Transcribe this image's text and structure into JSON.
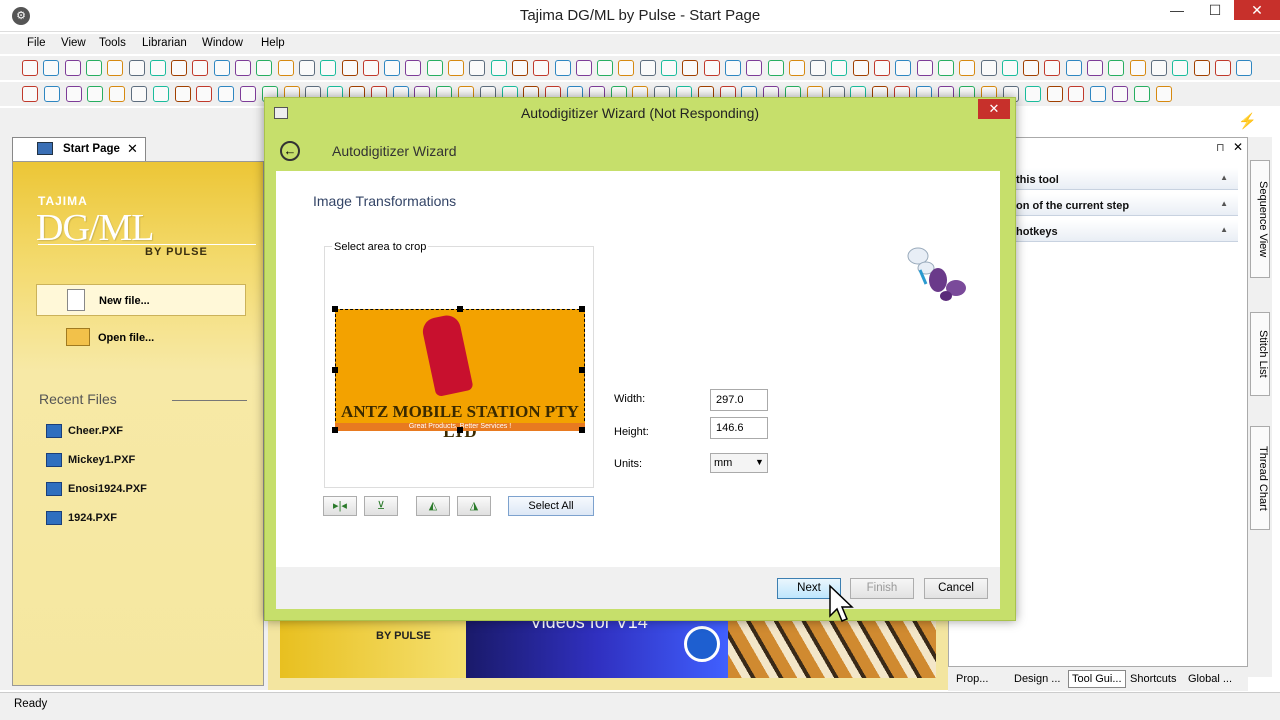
{
  "window": {
    "title": "Tajima DG/ML by Pulse - Start Page"
  },
  "menu": [
    "File",
    "View",
    "Tools",
    "Librarian",
    "Window",
    "Help"
  ],
  "tabs": {
    "start": "Start Page"
  },
  "start": {
    "logo_top": "TAJIMA",
    "logo_main": "DG/ML",
    "logo_by": "BY PULSE",
    "new_file": "New file...",
    "open_file": "Open file...",
    "recent_title": "Recent Files",
    "recent": [
      "Cheer.PXF",
      "Mickey1.PXF",
      "Enosi1924.PXF",
      "1924.PXF"
    ],
    "banner_text": "BY PULSE",
    "banner2_text": "Videos for V14"
  },
  "right": {
    "sections": [
      "this tool",
      "on of the current step",
      "hotkeys"
    ],
    "vtabs": [
      "Sequence View",
      "Stitch List",
      "Thread Chart"
    ],
    "bottom_tabs": [
      "Prop...",
      "Design ...",
      "Tool Gui...",
      "Shortcuts",
      "Global ..."
    ]
  },
  "status": {
    "text": "Ready"
  },
  "dialog": {
    "title": "Autodigitizer Wizard (Not Responding)",
    "subtitle": "Autodigitizer Wizard",
    "section": "Image Transformations",
    "crop_label": "Select area to crop",
    "crop_image_text": "ANTZ MOBILE STATION PTY LTD",
    "crop_image_sub": "Great Products, Better Services !",
    "select_all": "Select All",
    "width_label": "Width:",
    "width_value": "297.0",
    "height_label": "Height:",
    "height_value": "146.6",
    "units_label": "Units:",
    "units_value": "mm",
    "next": "Next",
    "finish": "Finish",
    "cancel": "Cancel"
  }
}
